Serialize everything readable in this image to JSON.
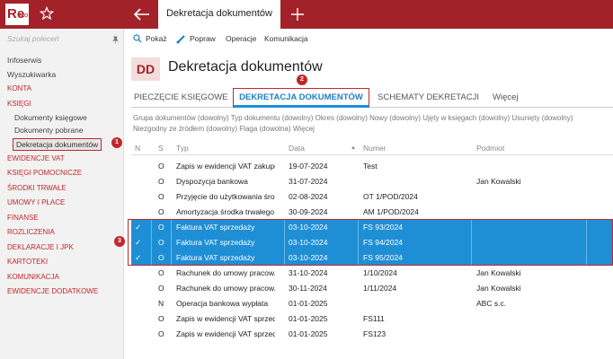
{
  "app": {
    "logo_text": "Re",
    "logo_sup": "PRO",
    "active_tab": "Dekretacja dokumentów"
  },
  "sidebar": {
    "search_placeholder": "Szukaj poleceń",
    "items": [
      {
        "label": "Infoserwis",
        "kind": "plain"
      },
      {
        "label": "Wyszukiwarka",
        "kind": "plain"
      },
      {
        "label": "KONTA",
        "kind": "red"
      },
      {
        "label": "KSIĘGI",
        "kind": "red"
      },
      {
        "label": "Dokumenty księgowe",
        "kind": "sub"
      },
      {
        "label": "Dokumenty pobrane",
        "kind": "sub"
      },
      {
        "label": "Dekretacja dokumentów",
        "kind": "selected"
      },
      {
        "label": "EWIDENCJE VAT",
        "kind": "red"
      },
      {
        "label": "KSIĘGI POMOCNICZE",
        "kind": "red"
      },
      {
        "label": "ŚRODKI TRWAŁE",
        "kind": "red"
      },
      {
        "label": "UMOWY I PŁACE",
        "kind": "red"
      },
      {
        "label": "FINANSE",
        "kind": "red"
      },
      {
        "label": "ROZLICZENIA",
        "kind": "red"
      },
      {
        "label": "DEKLARACJE I JPK",
        "kind": "red"
      },
      {
        "label": "KARTOTEKI",
        "kind": "red"
      },
      {
        "label": "KOMUNIKACJA",
        "kind": "red"
      },
      {
        "label": "EWIDENCJE DODATKOWE",
        "kind": "red"
      }
    ]
  },
  "toolbar": {
    "show": "Pokaż",
    "fix": "Popraw",
    "operations": "Operacje",
    "communication": "Komunikacja"
  },
  "header": {
    "icon_text": "DD",
    "title": "Dekretacja dokumentów"
  },
  "tabs": {
    "stamps": "PIECZĘCIE KSIĘGOWE",
    "decree": "DEKRETACJA DOKUMENTÓW",
    "schemes": "SCHEMATY DEKRETACJI",
    "more": "Więcej"
  },
  "filters": {
    "line1": "Grupa dokumentów (dowolny)   Typ dokumentu (dowolny)   Okres (dowolny)   Nowy (dowolny)   Ujęty w księgach (dowolny)   Usunięty (dowolny)",
    "line2": "Niezgodny ze źródłem (dowolny)   Flaga (dowolna)   Więcej"
  },
  "table": {
    "headers": {
      "n": "N",
      "s": "S",
      "typ": "Typ",
      "data": "Data",
      "numer": "Numer",
      "podmiot": "Podmiot"
    },
    "rows": [
      {
        "n": "",
        "s": "O",
        "typ": "Zapis w ewidencji VAT zakupu",
        "data": "19-07-2024",
        "numer": "Test",
        "podmiot": "",
        "selected": false
      },
      {
        "n": "",
        "s": "O",
        "typ": "Dyspozycja bankowa",
        "data": "31-07-2024",
        "numer": "",
        "podmiot": "Jan Kowalski",
        "selected": false
      },
      {
        "n": "",
        "s": "O",
        "typ": "Przyjęcie do użytkowania śro...",
        "data": "02-08-2024",
        "numer": "OT 1/POD/2024",
        "podmiot": "",
        "selected": false
      },
      {
        "n": "",
        "s": "O",
        "typ": "Amortyzacja środka trwałego",
        "data": "30-09-2024",
        "numer": "AM 1/POD/2024",
        "podmiot": "",
        "selected": false
      },
      {
        "n": "✓",
        "s": "O",
        "typ": "Faktura VAT sprzedaży",
        "data": "03-10-2024",
        "numer": "FS 93/2024",
        "podmiot": "",
        "selected": true
      },
      {
        "n": "✓",
        "s": "O",
        "typ": "Faktura VAT sprzedaży",
        "data": "03-10-2024",
        "numer": "FS 94/2024",
        "podmiot": "",
        "selected": true
      },
      {
        "n": "✓",
        "s": "O",
        "typ": "Faktura VAT sprzedaży",
        "data": "03-10-2024",
        "numer": "FS 95/2024",
        "podmiot": "",
        "selected": true
      },
      {
        "n": "",
        "s": "O",
        "typ": "Rachunek do umowy pracow...",
        "data": "31-10-2024",
        "numer": "1/10/2024",
        "podmiot": "Jan Kowalski",
        "selected": false
      },
      {
        "n": "",
        "s": "O",
        "typ": "Rachunek do umowy pracow...",
        "data": "30-11-2024",
        "numer": "1/11/2024",
        "podmiot": "Jan Kowalski",
        "selected": false
      },
      {
        "n": "",
        "s": "N",
        "typ": "Operacja bankowa wypłata",
        "data": "01-01-2025",
        "numer": "",
        "podmiot": "ABC s.c.",
        "selected": false
      },
      {
        "n": "",
        "s": "O",
        "typ": "Zapis w ewidencji VAT sprzed...",
        "data": "01-01-2025",
        "numer": "FS111",
        "podmiot": "",
        "selected": false
      },
      {
        "n": "",
        "s": "O",
        "typ": "Zapis w ewidencji VAT sprzed...",
        "data": "01-01-2025",
        "numer": "FS123",
        "podmiot": "",
        "selected": false
      }
    ]
  },
  "callouts": {
    "one": "1",
    "two": "2",
    "three": "3"
  },
  "colors": {
    "brand": "#a3222a",
    "selection": "#1e8fd5",
    "accent_tab": "#1f7fc4"
  }
}
